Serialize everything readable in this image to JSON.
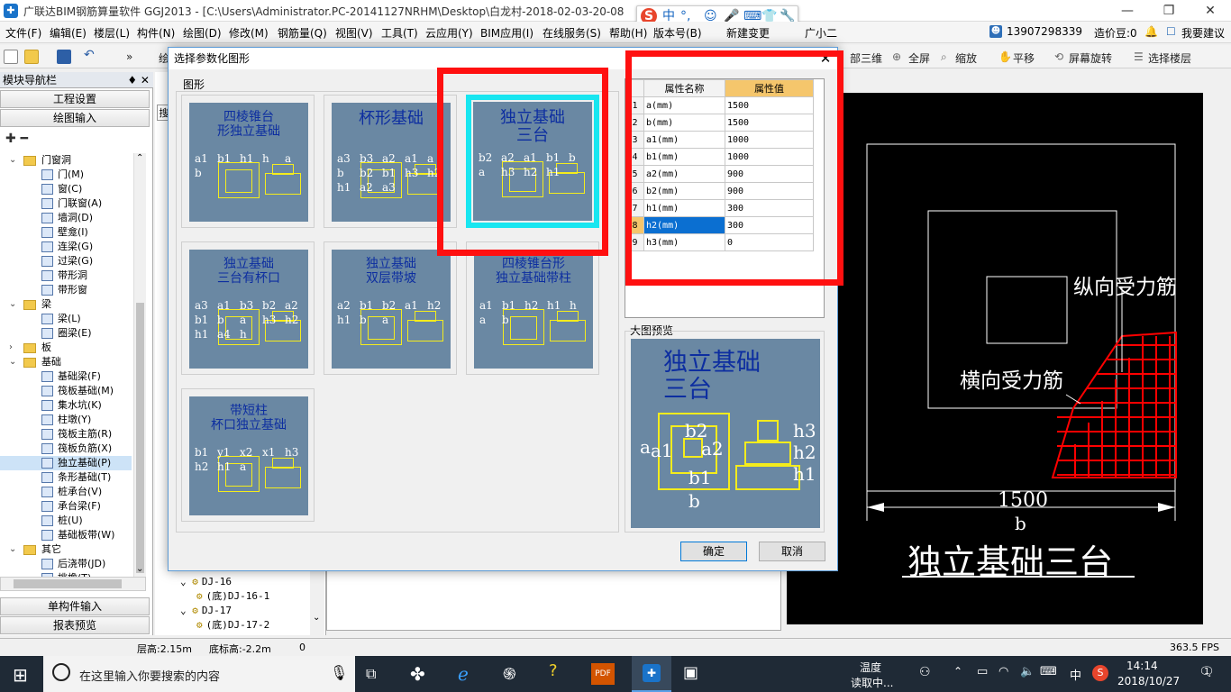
{
  "window": {
    "title": "广联达BIM钢筋算量软件 GGJ2013 - [C:\\Users\\Administrator.PC-20141127NRHM\\Desktop\\白龙村-2018-02-03-20-08",
    "min": "—",
    "restore": "❐",
    "close": "✕"
  },
  "ime": {
    "logo": "S",
    "lang": "中",
    "punct": "°,",
    "items": [
      "☺",
      "🎤",
      "⌨",
      "👕",
      "🔧"
    ]
  },
  "menu": [
    "文件(F)",
    "编辑(E)",
    "楼层(L)",
    "构件(N)",
    "绘图(D)",
    "修改(M)",
    "钢筋量(Q)",
    "视图(V)",
    "工具(T)",
    "云应用(Y)",
    "BIM应用(I)",
    "在线服务(S)",
    "帮助(H)",
    "版本号(B)",
    "新建变更",
    "广小二"
  ],
  "account": {
    "phone": "13907298339",
    "price_bean": "造价豆:0",
    "suggest": "我要建议"
  },
  "toolbar": {
    "items": [
      "部三维",
      "全屏",
      "缩放",
      "平移",
      "屏幕旋转",
      "选择楼层"
    ],
    "extra": "绘"
  },
  "nav": {
    "title": "模块导航栏",
    "pin": "♦ ✕",
    "project_settings": "工程设置",
    "drawing_input": "绘图输入",
    "single_input": "单构件输入",
    "report_preview": "报表预览",
    "tree": [
      {
        "label": "门窗洞",
        "type": "folder",
        "level": 1,
        "exp": "⌄"
      },
      {
        "label": "门(M)",
        "type": "item",
        "level": 2
      },
      {
        "label": "窗(C)",
        "type": "item",
        "level": 2
      },
      {
        "label": "门联窗(A)",
        "type": "item",
        "level": 2
      },
      {
        "label": "墙洞(D)",
        "type": "item",
        "level": 2
      },
      {
        "label": "壁龛(I)",
        "type": "item",
        "level": 2
      },
      {
        "label": "连梁(G)",
        "type": "item",
        "level": 2
      },
      {
        "label": "过梁(G)",
        "type": "item",
        "level": 2
      },
      {
        "label": "带形洞",
        "type": "item",
        "level": 2
      },
      {
        "label": "带形窗",
        "type": "item",
        "level": 2
      },
      {
        "label": "梁",
        "type": "folder",
        "level": 1,
        "exp": "⌄"
      },
      {
        "label": "梁(L)",
        "type": "item",
        "level": 2
      },
      {
        "label": "圈梁(E)",
        "type": "item",
        "level": 2
      },
      {
        "label": "板",
        "type": "folder",
        "level": 1,
        "exp": "›"
      },
      {
        "label": "基础",
        "type": "folder",
        "level": 1,
        "exp": "⌄"
      },
      {
        "label": "基础梁(F)",
        "type": "item",
        "level": 2
      },
      {
        "label": "筏板基础(M)",
        "type": "item",
        "level": 2
      },
      {
        "label": "集水坑(K)",
        "type": "item",
        "level": 2
      },
      {
        "label": "柱墩(Y)",
        "type": "item",
        "level": 2
      },
      {
        "label": "筏板主筋(R)",
        "type": "item",
        "level": 2
      },
      {
        "label": "筏板负筋(X)",
        "type": "item",
        "level": 2
      },
      {
        "label": "独立基础(P)",
        "type": "item",
        "level": 2,
        "selected": true
      },
      {
        "label": "条形基础(T)",
        "type": "item",
        "level": 2
      },
      {
        "label": "桩承台(V)",
        "type": "item",
        "level": 2
      },
      {
        "label": "承台梁(F)",
        "type": "item",
        "level": 2
      },
      {
        "label": "桩(U)",
        "type": "item",
        "level": 2
      },
      {
        "label": "基础板带(W)",
        "type": "item",
        "level": 2
      },
      {
        "label": "其它",
        "type": "folder",
        "level": 1,
        "exp": "⌄"
      },
      {
        "label": "后浇带(JD)",
        "type": "item",
        "level": 2
      },
      {
        "label": "挑檐(T)",
        "type": "item",
        "level": 2
      }
    ]
  },
  "subtree": {
    "rows": [
      {
        "label": "DJ-16",
        "level": 1
      },
      {
        "label": "(底)DJ-16-1",
        "level": 2
      },
      {
        "label": "DJ-17",
        "level": 1
      },
      {
        "label": "(底)DJ-17-2",
        "level": 2
      }
    ],
    "search_tab": "搜"
  },
  "status": {
    "floor_height": "层高:2.15m",
    "base_height": "底标高:-2.2m",
    "zero": "0",
    "fps": "363.5 FPS"
  },
  "taskbar": {
    "search_placeholder": "在这里输入你要搜索的内容",
    "temp_title": "温度",
    "temp_state": "读取中...",
    "ime": "中",
    "time": "14:14",
    "date": "2018/10/27",
    "notif": "1"
  },
  "dialog": {
    "title": "选择参数化图形",
    "close": "✕",
    "group_label": "图形",
    "preview_label": "大图预览",
    "ok": "确定",
    "cancel": "取消",
    "thumbs": [
      {
        "caption": "四棱锥台\n形独立基础",
        "labels": [
          "a1",
          "b1",
          "h1",
          "h",
          "a",
          "b"
        ]
      },
      {
        "caption": "杯形基础",
        "labels": [
          "a3",
          "b3",
          "a2",
          "a1",
          "a",
          "b",
          "b2",
          "b1",
          "h3",
          "h2",
          "h1",
          "a2",
          "a3"
        ]
      },
      {
        "caption": "独立基础\n三台",
        "labels": [
          "b2",
          "a2",
          "a1",
          "b1",
          "b",
          "a",
          "h3",
          "h2",
          "h1"
        ],
        "selected": true
      },
      {
        "caption": "独立基础\n三台有杯口",
        "labels": [
          "a3",
          "a1",
          "b3",
          "b2",
          "a2",
          "b1",
          "b",
          "a",
          "h3",
          "h2",
          "h1",
          "a4",
          "h"
        ]
      },
      {
        "caption": "独立基础\n双层带坡",
        "labels": [
          "a2",
          "b1",
          "b2",
          "a1",
          "h2",
          "h1",
          "b",
          "a"
        ]
      },
      {
        "caption": "四棱锥台形\n独立基础带柱",
        "labels": [
          "a1",
          "b1",
          "h2",
          "h1",
          "h",
          "a",
          "b"
        ]
      },
      {
        "caption": "带短柱\n杯口独立基础",
        "labels": [
          "b1",
          "y1",
          "x2",
          "x1",
          "h3",
          "h2",
          "h1",
          "a"
        ]
      }
    ],
    "grid": {
      "col_name": "属性名称",
      "col_value": "属性值",
      "rows": [
        {
          "n": "1",
          "name": "a(mm)",
          "value": "1500"
        },
        {
          "n": "2",
          "name": "b(mm)",
          "value": "1500"
        },
        {
          "n": "3",
          "name": "a1(mm)",
          "value": "1000"
        },
        {
          "n": "4",
          "name": "b1(mm)",
          "value": "1000"
        },
        {
          "n": "5",
          "name": "a2(mm)",
          "value": "900"
        },
        {
          "n": "6",
          "name": "b2(mm)",
          "value": "900"
        },
        {
          "n": "7",
          "name": "h1(mm)",
          "value": "300"
        },
        {
          "n": "8",
          "name": "h2(mm)",
          "value": "300",
          "active": true
        },
        {
          "n": "9",
          "name": "h3(mm)",
          "value": "0"
        }
      ]
    },
    "preview": {
      "caption": "独立基础\n三台",
      "labels": [
        "b2",
        "a2",
        "a1",
        "b1",
        "b",
        "a",
        "h3",
        "h2",
        "h1"
      ]
    }
  },
  "canvas": {
    "label_long": "纵向受力筋",
    "label_trans": "横向受力筋",
    "dim_value": "1500",
    "dim_axis": "b",
    "title": "独立基础三台",
    "side_text": "1500"
  },
  "colors": {
    "highlight_box": "#ff1010",
    "selected_thumb": "#18e6f0",
    "thumb_bg": "#6a88a3",
    "line_yellow": "#f4ec1c",
    "rebar_red": "#ff0000"
  }
}
